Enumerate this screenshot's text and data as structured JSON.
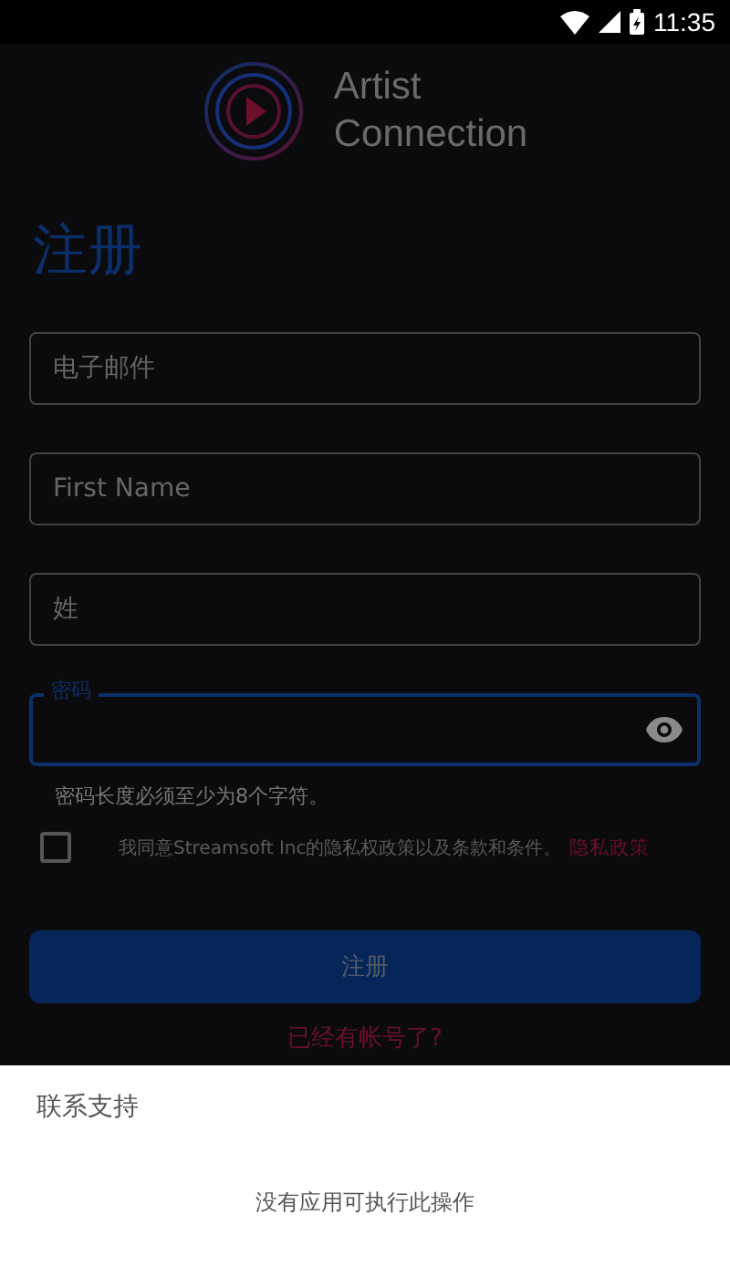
{
  "status_bar": {
    "time": "11:35"
  },
  "logo": {
    "line_1": "Artist",
    "line_2": "Connection"
  },
  "title": "注册",
  "fields": [
    {
      "kind": "text",
      "placeholder": "电子邮件",
      "focused": false
    },
    {
      "kind": "text",
      "placeholder": "First Name",
      "focused": false
    },
    {
      "kind": "text",
      "placeholder": "姓",
      "focused": false
    },
    {
      "kind": "password",
      "label": "密码",
      "focused": true
    }
  ],
  "password_hint": "密码长度必须至少为8个字符。",
  "agreement": {
    "checked": false,
    "text": "我同意Streamsoft Inc的隐私权政策以及条款和条件。",
    "link": "隐私政策"
  },
  "submit_button": "注册",
  "login_link": "已经有帐号了?",
  "sheet": {
    "title": "联系支持",
    "message": "没有应用可执行此操作"
  }
}
